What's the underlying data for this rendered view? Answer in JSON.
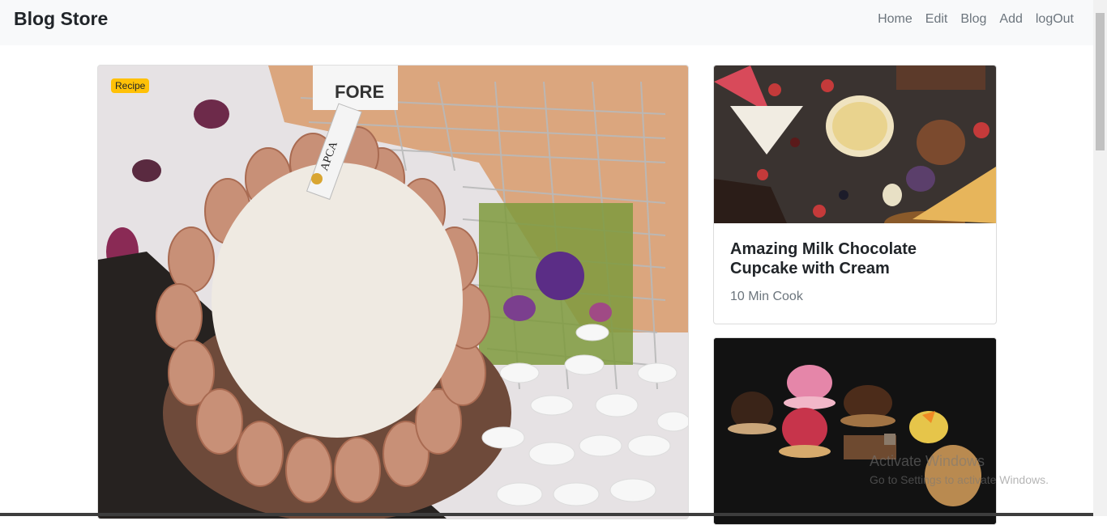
{
  "brand": "Blog Store",
  "nav": [
    "Home",
    "Edit",
    "Blog",
    "Add",
    "logOut"
  ],
  "featured": {
    "badge": "Recipe",
    "cup_text": "FORE",
    "tag_text": "APCA"
  },
  "cards": [
    {
      "title": "Amazing Milk Chocolate Cupcake with Cream",
      "subtitle": "10 Min Cook"
    }
  ],
  "watermark": {
    "line1": "Activate Windows",
    "line2": "Go to Settings to activate Windows."
  }
}
